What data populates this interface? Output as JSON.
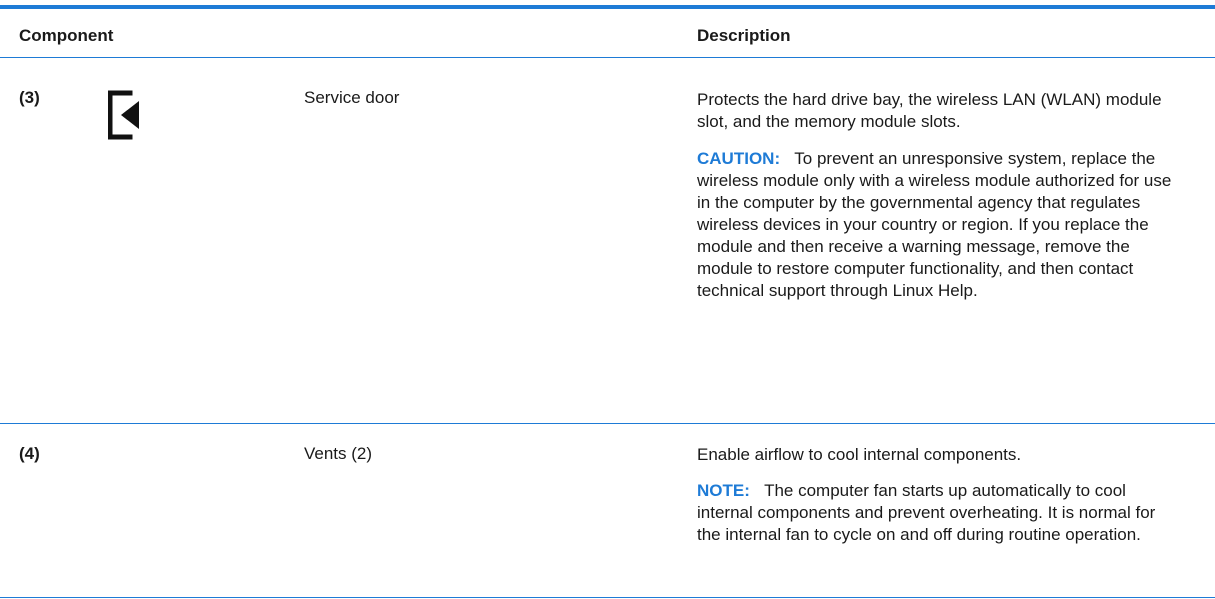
{
  "header": {
    "component": "Component",
    "description": "Description"
  },
  "rows": [
    {
      "number": "(3)",
      "icon": "service-door-icon",
      "name": "Service door",
      "description": "Protects the hard drive bay, the wireless LAN (WLAN) module slot, and the memory module slots.",
      "note_label": "CAUTION:",
      "note_text": "To prevent an unresponsive system, replace the wireless module only with a wireless module authorized for use in the computer by the governmental agency that regulates wireless devices in your country or region. If you replace the module and then receive a warning message, remove the module to restore computer functionality, and then contact technical support through Linux Help."
    },
    {
      "number": "(4)",
      "name": "Vents (2)",
      "description": "Enable airflow to cool internal components.",
      "note_label": "NOTE:",
      "note_text": "The computer fan starts up automatically to cool internal components and prevent overheating. It is normal for the internal fan to cycle on and off during routine operation."
    }
  ],
  "colors": {
    "accent": "#1e7bd6",
    "text": "#1a1a1a"
  }
}
